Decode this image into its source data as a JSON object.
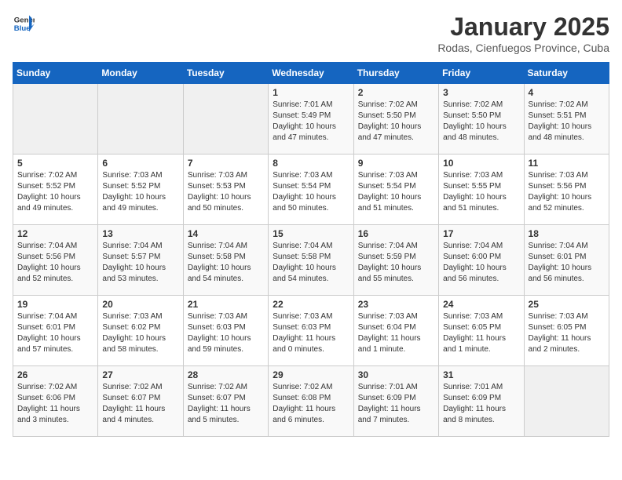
{
  "header": {
    "logo_general": "General",
    "logo_blue": "Blue",
    "title": "January 2025",
    "subtitle": "Rodas, Cienfuegos Province, Cuba"
  },
  "weekdays": [
    "Sunday",
    "Monday",
    "Tuesday",
    "Wednesday",
    "Thursday",
    "Friday",
    "Saturday"
  ],
  "weeks": [
    [
      {
        "day": "",
        "info": ""
      },
      {
        "day": "",
        "info": ""
      },
      {
        "day": "",
        "info": ""
      },
      {
        "day": "1",
        "info": "Sunrise: 7:01 AM\nSunset: 5:49 PM\nDaylight: 10 hours\nand 47 minutes."
      },
      {
        "day": "2",
        "info": "Sunrise: 7:02 AM\nSunset: 5:50 PM\nDaylight: 10 hours\nand 47 minutes."
      },
      {
        "day": "3",
        "info": "Sunrise: 7:02 AM\nSunset: 5:50 PM\nDaylight: 10 hours\nand 48 minutes."
      },
      {
        "day": "4",
        "info": "Sunrise: 7:02 AM\nSunset: 5:51 PM\nDaylight: 10 hours\nand 48 minutes."
      }
    ],
    [
      {
        "day": "5",
        "info": "Sunrise: 7:02 AM\nSunset: 5:52 PM\nDaylight: 10 hours\nand 49 minutes."
      },
      {
        "day": "6",
        "info": "Sunrise: 7:03 AM\nSunset: 5:52 PM\nDaylight: 10 hours\nand 49 minutes."
      },
      {
        "day": "7",
        "info": "Sunrise: 7:03 AM\nSunset: 5:53 PM\nDaylight: 10 hours\nand 50 minutes."
      },
      {
        "day": "8",
        "info": "Sunrise: 7:03 AM\nSunset: 5:54 PM\nDaylight: 10 hours\nand 50 minutes."
      },
      {
        "day": "9",
        "info": "Sunrise: 7:03 AM\nSunset: 5:54 PM\nDaylight: 10 hours\nand 51 minutes."
      },
      {
        "day": "10",
        "info": "Sunrise: 7:03 AM\nSunset: 5:55 PM\nDaylight: 10 hours\nand 51 minutes."
      },
      {
        "day": "11",
        "info": "Sunrise: 7:03 AM\nSunset: 5:56 PM\nDaylight: 10 hours\nand 52 minutes."
      }
    ],
    [
      {
        "day": "12",
        "info": "Sunrise: 7:04 AM\nSunset: 5:56 PM\nDaylight: 10 hours\nand 52 minutes."
      },
      {
        "day": "13",
        "info": "Sunrise: 7:04 AM\nSunset: 5:57 PM\nDaylight: 10 hours\nand 53 minutes."
      },
      {
        "day": "14",
        "info": "Sunrise: 7:04 AM\nSunset: 5:58 PM\nDaylight: 10 hours\nand 54 minutes."
      },
      {
        "day": "15",
        "info": "Sunrise: 7:04 AM\nSunset: 5:58 PM\nDaylight: 10 hours\nand 54 minutes."
      },
      {
        "day": "16",
        "info": "Sunrise: 7:04 AM\nSunset: 5:59 PM\nDaylight: 10 hours\nand 55 minutes."
      },
      {
        "day": "17",
        "info": "Sunrise: 7:04 AM\nSunset: 6:00 PM\nDaylight: 10 hours\nand 56 minutes."
      },
      {
        "day": "18",
        "info": "Sunrise: 7:04 AM\nSunset: 6:01 PM\nDaylight: 10 hours\nand 56 minutes."
      }
    ],
    [
      {
        "day": "19",
        "info": "Sunrise: 7:04 AM\nSunset: 6:01 PM\nDaylight: 10 hours\nand 57 minutes."
      },
      {
        "day": "20",
        "info": "Sunrise: 7:03 AM\nSunset: 6:02 PM\nDaylight: 10 hours\nand 58 minutes."
      },
      {
        "day": "21",
        "info": "Sunrise: 7:03 AM\nSunset: 6:03 PM\nDaylight: 10 hours\nand 59 minutes."
      },
      {
        "day": "22",
        "info": "Sunrise: 7:03 AM\nSunset: 6:03 PM\nDaylight: 11 hours\nand 0 minutes."
      },
      {
        "day": "23",
        "info": "Sunrise: 7:03 AM\nSunset: 6:04 PM\nDaylight: 11 hours\nand 1 minute."
      },
      {
        "day": "24",
        "info": "Sunrise: 7:03 AM\nSunset: 6:05 PM\nDaylight: 11 hours\nand 1 minute."
      },
      {
        "day": "25",
        "info": "Sunrise: 7:03 AM\nSunset: 6:05 PM\nDaylight: 11 hours\nand 2 minutes."
      }
    ],
    [
      {
        "day": "26",
        "info": "Sunrise: 7:02 AM\nSunset: 6:06 PM\nDaylight: 11 hours\nand 3 minutes."
      },
      {
        "day": "27",
        "info": "Sunrise: 7:02 AM\nSunset: 6:07 PM\nDaylight: 11 hours\nand 4 minutes."
      },
      {
        "day": "28",
        "info": "Sunrise: 7:02 AM\nSunset: 6:07 PM\nDaylight: 11 hours\nand 5 minutes."
      },
      {
        "day": "29",
        "info": "Sunrise: 7:02 AM\nSunset: 6:08 PM\nDaylight: 11 hours\nand 6 minutes."
      },
      {
        "day": "30",
        "info": "Sunrise: 7:01 AM\nSunset: 6:09 PM\nDaylight: 11 hours\nand 7 minutes."
      },
      {
        "day": "31",
        "info": "Sunrise: 7:01 AM\nSunset: 6:09 PM\nDaylight: 11 hours\nand 8 minutes."
      },
      {
        "day": "",
        "info": ""
      }
    ]
  ]
}
